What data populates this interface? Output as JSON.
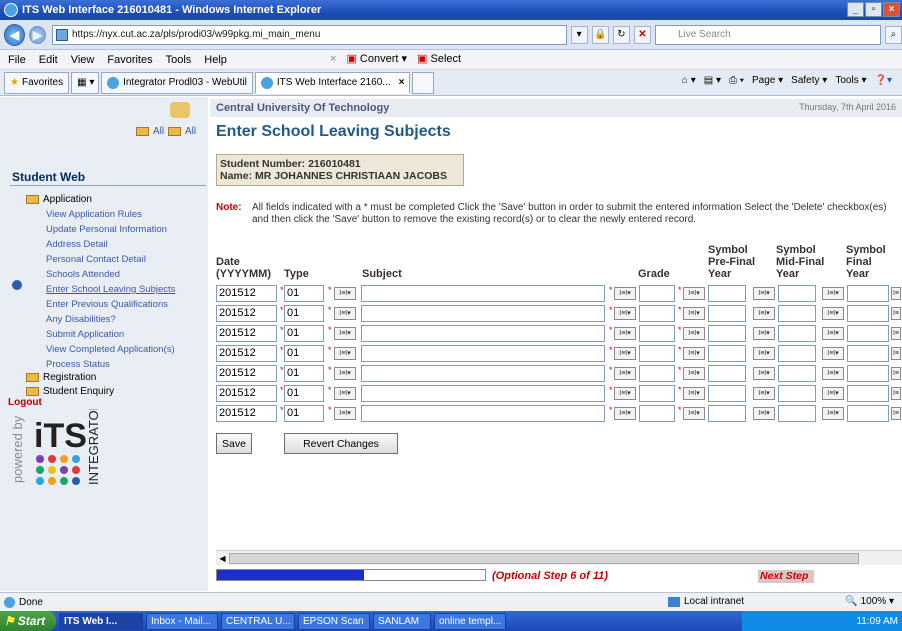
{
  "window": {
    "title": "ITS Web Interface 216010481 - Windows Internet Explorer"
  },
  "address": {
    "url": "https://nyx.cut.ac.za/pls/prodi03/w99pkg.mi_main_menu",
    "search_placeholder": "Live Search"
  },
  "menu": {
    "items": [
      "File",
      "Edit",
      "View",
      "Favorites",
      "Tools",
      "Help"
    ],
    "convert": "Convert",
    "select": "Select"
  },
  "tabs": {
    "favorites": "Favorites",
    "items": [
      "Integrator Prodl03 - WebUtil",
      "ITS Web Interface 2160..."
    ]
  },
  "commands": {
    "page": "Page",
    "safety": "Safety",
    "tools": "Tools"
  },
  "sidebar": {
    "all1": "All",
    "all2": "All",
    "heading": "Student Web",
    "application": "Application",
    "subitems": [
      "View Application Rules",
      "Update Personal Information",
      "Address Detail",
      "Personal Contact Detail",
      "Schools Attended",
      "Enter School Leaving Subjects",
      "Enter Previous Qualifications",
      "Any Disabilities?",
      "Submit Application",
      "View Completed Application(s)",
      "Process Status"
    ],
    "registration": "Registration",
    "enquiry": "Student Enquiry",
    "logout": "Logout",
    "powered": "powered by",
    "logo_its": "iTS",
    "logo_integrator": "INTEGRATOR"
  },
  "header": {
    "org": "Central University Of Technology",
    "date": "Thursday, 7th April 2016"
  },
  "page": {
    "title": "Enter School Leaving Subjects",
    "student_number": "Student Number: 216010481",
    "student_name": "Name: MR JOHANNES CHRISTIAAN JACOBS",
    "note_label": "Note:",
    "note_text": "All fields indicated with a * must be completed Click the 'Save' button in order to submit the entered information Select the 'Delete' checkbox(es) and then click the 'Save' button to remove the existing record(s) or to clear the newly entered record."
  },
  "table": {
    "headers": {
      "date1": "Date",
      "date2": "(YYYYMM)",
      "type": "Type",
      "subject": "Subject",
      "grade": "Grade",
      "spf1": "Symbol",
      "spf2": "Pre-Final",
      "spf3": "Year",
      "smf1": "Symbol",
      "smf2": "Mid-Final",
      "smf3": "Year",
      "sf1": "Symbol",
      "sf2": "Final",
      "sf3": "Year"
    },
    "rows": [
      {
        "date": "201512",
        "type": "01"
      },
      {
        "date": "201512",
        "type": "01"
      },
      {
        "date": "201512",
        "type": "01"
      },
      {
        "date": "201512",
        "type": "01"
      },
      {
        "date": "201512",
        "type": "01"
      },
      {
        "date": "201512",
        "type": "01"
      },
      {
        "date": "201512",
        "type": "01"
      }
    ]
  },
  "buttons": {
    "save": "Save",
    "revert": "Revert Changes"
  },
  "progress": {
    "fraction": 0.55,
    "step_text": "(Optional Step 6 of 11)",
    "next": "Next Step"
  },
  "status": {
    "done": "Done",
    "zone": "Local intranet",
    "zoom": "100%"
  },
  "taskbar": {
    "start": "Start",
    "items": [
      "ITS Web I...",
      "Inbox - Mail...",
      "CENTRAL U...",
      "EPSON Scan",
      "SANLAM",
      "online templ..."
    ],
    "clock": "11:09 AM"
  }
}
